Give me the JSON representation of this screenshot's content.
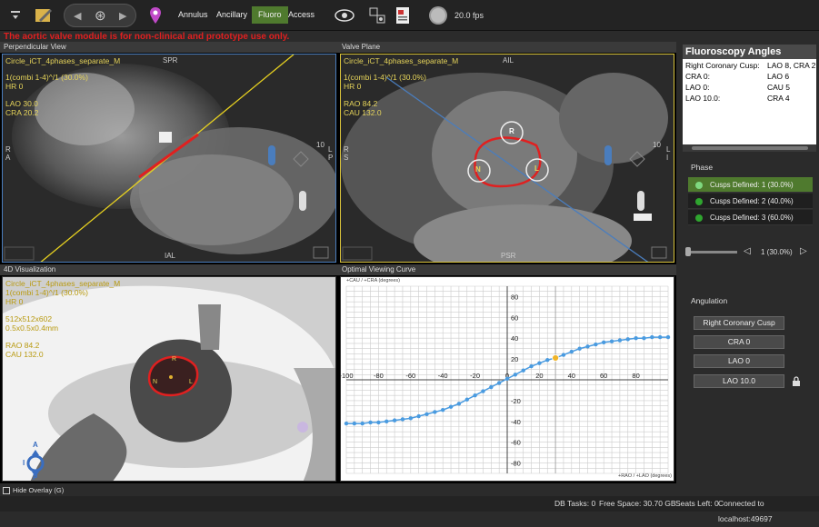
{
  "warning": "The aortic valve module is for non-clinical and prototype use only.",
  "toolbar": {
    "tabs": [
      "Annulus",
      "Ancillary",
      "Fluoro",
      "Access"
    ],
    "active_tab": "Fluoro",
    "fps": "20.0 fps"
  },
  "panels": {
    "perpendicular": {
      "title": "Perpendicular View",
      "series": "Circle_iCT_4phases_separate_M",
      "phase": "1(combi 1-4)^/1 (30.0%)",
      "hr": "HR 0",
      "lao": "LAO 30.0",
      "cra": "CRA 20.2",
      "top": "SPR",
      "bottom": "IAL",
      "left": "R\nA",
      "right": "L\nP",
      "zoom": "10"
    },
    "valve_plane": {
      "title": "Valve Plane",
      "series": "Circle_iCT_4phases_separate_M",
      "phase": "1(combi 1-4)^/1 (30.0%)",
      "hr": "HR 0",
      "rao": "RAO 84.2",
      "cau": "CAU 132.0",
      "top": "AIL",
      "bottom": "PSR",
      "left": "R\nS",
      "right": "L\nI",
      "zoom": "10",
      "cusps": [
        "R",
        "N",
        "L"
      ]
    },
    "viz4d": {
      "title": "4D Visualization",
      "series": "Circle_iCT_4phases_separate_M",
      "phase": "1(combi 1-4)^/1 (30.0%)",
      "hr": "HR 0",
      "dims": "512x512x602",
      "spacing": "0.5x0.5x0.4mm",
      "rao": "RAO 84.2",
      "cau": "CAU 132.0",
      "cusps": [
        "R",
        "N",
        "L"
      ],
      "orient": [
        "A",
        "I",
        "P"
      ]
    },
    "ovc": {
      "title": "Optimal Viewing Curve",
      "y_caption": "+CAU / +CRA (degrees)",
      "x_caption": "+RAO / +LAO (degrees)"
    }
  },
  "fluoro_angles": {
    "title": "Fluoroscopy Angles",
    "rows": [
      {
        "k": "Right Coronary Cusp:",
        "v": "LAO 8, CRA 2"
      },
      {
        "k": "CRA 0:",
        "v": "LAO 6"
      },
      {
        "k": "LAO 0:",
        "v": "CAU 5"
      },
      {
        "k": "LAO 10.0:",
        "v": "CRA 4"
      }
    ]
  },
  "phase": {
    "title": "Phase",
    "items": [
      "Cusps Defined: 1 (30.0%)",
      "Cusps Defined: 2 (40.0%)",
      "Cusps Defined: 3 (60.0%)"
    ],
    "slider_value": "1 (30.0%)"
  },
  "angulation": {
    "title": "Angulation",
    "buttons": [
      "Right Coronary Cusp",
      "CRA 0",
      "LAO 0",
      "LAO 10.0"
    ]
  },
  "hide_overlay": "Hide Overlay (G)",
  "status": {
    "db_tasks": "DB Tasks: 0",
    "free_space": "Free Space: 30.70 GB",
    "seats": "Seats Left: 0",
    "connected": "Connected to localhost:49697"
  },
  "chart_data": {
    "type": "line",
    "xlim": [
      -100,
      100
    ],
    "ylim": [
      -90,
      90
    ],
    "x_ticks": [
      -100,
      -80,
      -60,
      -40,
      -20,
      0,
      20,
      40,
      60,
      80
    ],
    "y_ticks": [
      -80,
      -60,
      -40,
      -20,
      20,
      40,
      60,
      80
    ],
    "x": [
      -100,
      -95,
      -90,
      -85,
      -80,
      -75,
      -70,
      -65,
      -60,
      -55,
      -50,
      -45,
      -40,
      -35,
      -30,
      -25,
      -20,
      -15,
      -10,
      -5,
      0,
      5,
      10,
      15,
      20,
      25,
      30,
      35,
      40,
      45,
      50,
      55,
      60,
      65,
      70,
      75,
      80,
      85,
      90,
      95,
      100
    ],
    "y": [
      -42,
      -42,
      -42,
      -41,
      -41,
      -40,
      -39,
      -38,
      -37,
      -35,
      -33,
      -31,
      -29,
      -26,
      -23,
      -19,
      -15,
      -11,
      -7,
      -3,
      1,
      5,
      9,
      13,
      16,
      19,
      21,
      24,
      27,
      30,
      32,
      34,
      36,
      37,
      38,
      39,
      40,
      40,
      41,
      41,
      41
    ],
    "highlight": {
      "x": 30,
      "y": 21
    },
    "grid": true,
    "line_color": "#4a9be0",
    "highlight_color": "#f0b429"
  }
}
